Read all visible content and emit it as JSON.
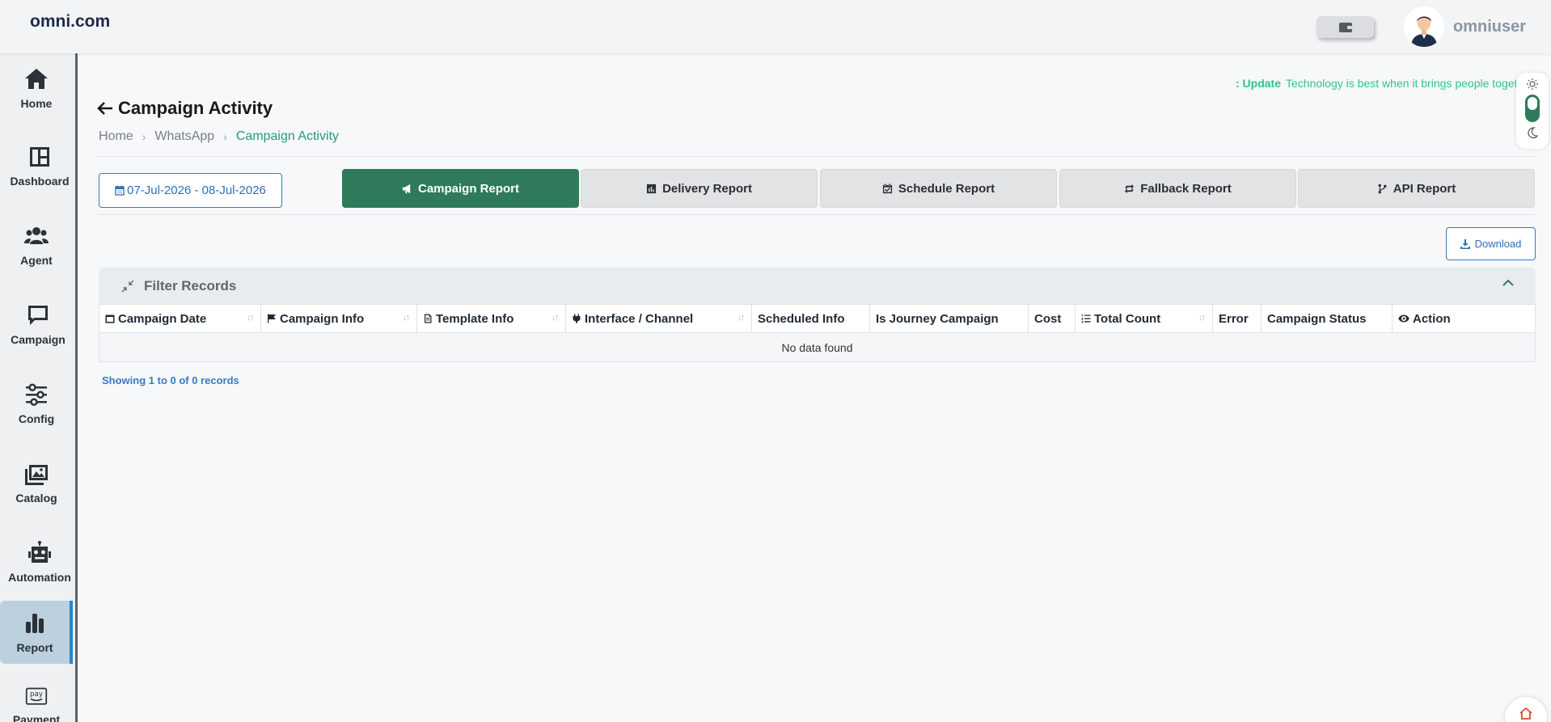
{
  "header": {
    "logo": "omni.com",
    "username": "omniuser"
  },
  "sidebar": {
    "items": [
      {
        "label": "Home",
        "icon": "home-icon"
      },
      {
        "label": "Dashboard",
        "icon": "dashboard-icon"
      },
      {
        "label": "Agent",
        "icon": "agents-icon"
      },
      {
        "label": "Campaign",
        "icon": "chat-bubble-icon"
      },
      {
        "label": "Config",
        "icon": "sliders-icon"
      },
      {
        "label": "Catalog",
        "icon": "image-gallery-icon"
      },
      {
        "label": "Automation",
        "icon": "robot-icon"
      },
      {
        "label": "Report",
        "icon": "bar-chart-icon",
        "active": true
      },
      {
        "label": "Payment",
        "icon": "pay-icon"
      }
    ]
  },
  "notice": {
    "prefix": ": Update",
    "text": "Technology is best when it brings people together"
  },
  "page": {
    "title": "Campaign Activity",
    "breadcrumb": [
      "Home",
      "WhatsApp",
      "Campaign Activity"
    ]
  },
  "controls": {
    "date_range": "07-Jul-2026 - 08-Jul-2026",
    "tabs": [
      {
        "label": "Campaign Report",
        "active": true
      },
      {
        "label": "Delivery Report"
      },
      {
        "label": "Schedule Report"
      },
      {
        "label": "Fallback Report"
      },
      {
        "label": "API Report"
      }
    ],
    "download_label": "Download"
  },
  "filter": {
    "label": "Filter Records"
  },
  "table": {
    "columns": [
      "Campaign Date",
      "Campaign Info",
      "Template Info",
      "Interface / Channel",
      "Scheduled Info",
      "Is Journey Campaign",
      "Cost",
      "Total Count",
      "Error",
      "Campaign Status",
      "Action"
    ],
    "empty_message": "No data found"
  },
  "footer": {
    "records_text": "Showing 1 to 0 of 0 records"
  },
  "colors": {
    "primary_green": "#2f7a5b",
    "accent_blue": "#3a7ac3",
    "notice_green": "#30c48b"
  }
}
